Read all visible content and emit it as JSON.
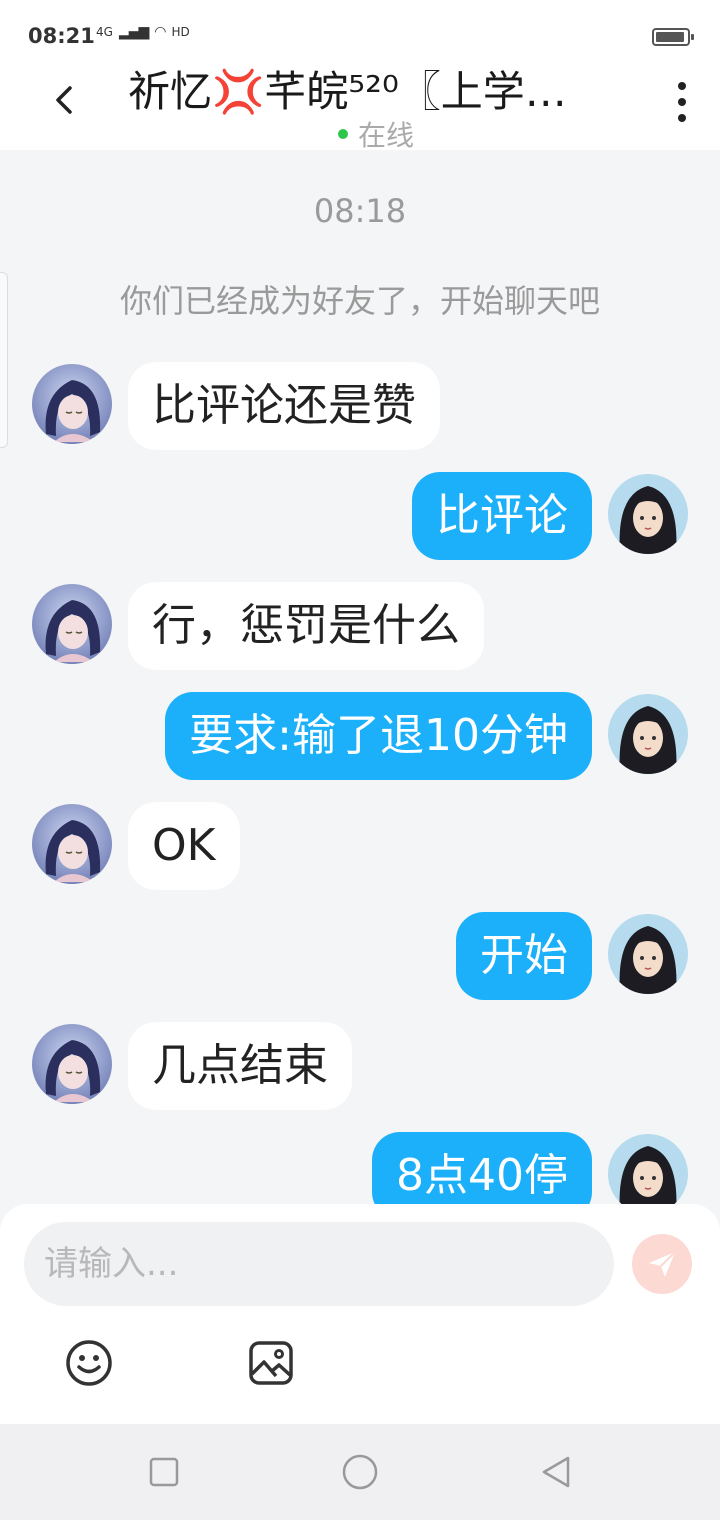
{
  "status": {
    "time": "08:21",
    "network": "4G",
    "hd": "HD"
  },
  "header": {
    "title": "祈忆💢芊皖⁵²⁰〖上学…",
    "online_status": "在线"
  },
  "chat": {
    "timestamp": "08:18",
    "system_message": "你们已经成为好友了，开始聊天吧",
    "messages": [
      {
        "side": "left",
        "text": "比评论还是赞"
      },
      {
        "side": "right",
        "text": "比评论"
      },
      {
        "side": "left",
        "text": "行，惩罚是什么"
      },
      {
        "side": "right",
        "text": "要求:输了退10分钟"
      },
      {
        "side": "left",
        "text": "OK"
      },
      {
        "side": "right",
        "text": "开始"
      },
      {
        "side": "left",
        "text": "几点结束"
      },
      {
        "side": "right",
        "text": "8点40停"
      }
    ]
  },
  "input": {
    "placeholder": "请输入..."
  },
  "colors": {
    "accent": "#1db0fa",
    "bubble_left": "#ffffff",
    "background": "#f4f5f7",
    "online": "#2cc64a",
    "send_button": "#fcd9d3"
  },
  "icons": {
    "back": "chevron-left-icon",
    "more": "more-vertical-icon",
    "send": "send-icon",
    "emoji": "emoji-icon",
    "image": "image-icon",
    "nav_recent": "square-icon",
    "nav_home": "circle-icon",
    "nav_back": "triangle-back-icon"
  }
}
